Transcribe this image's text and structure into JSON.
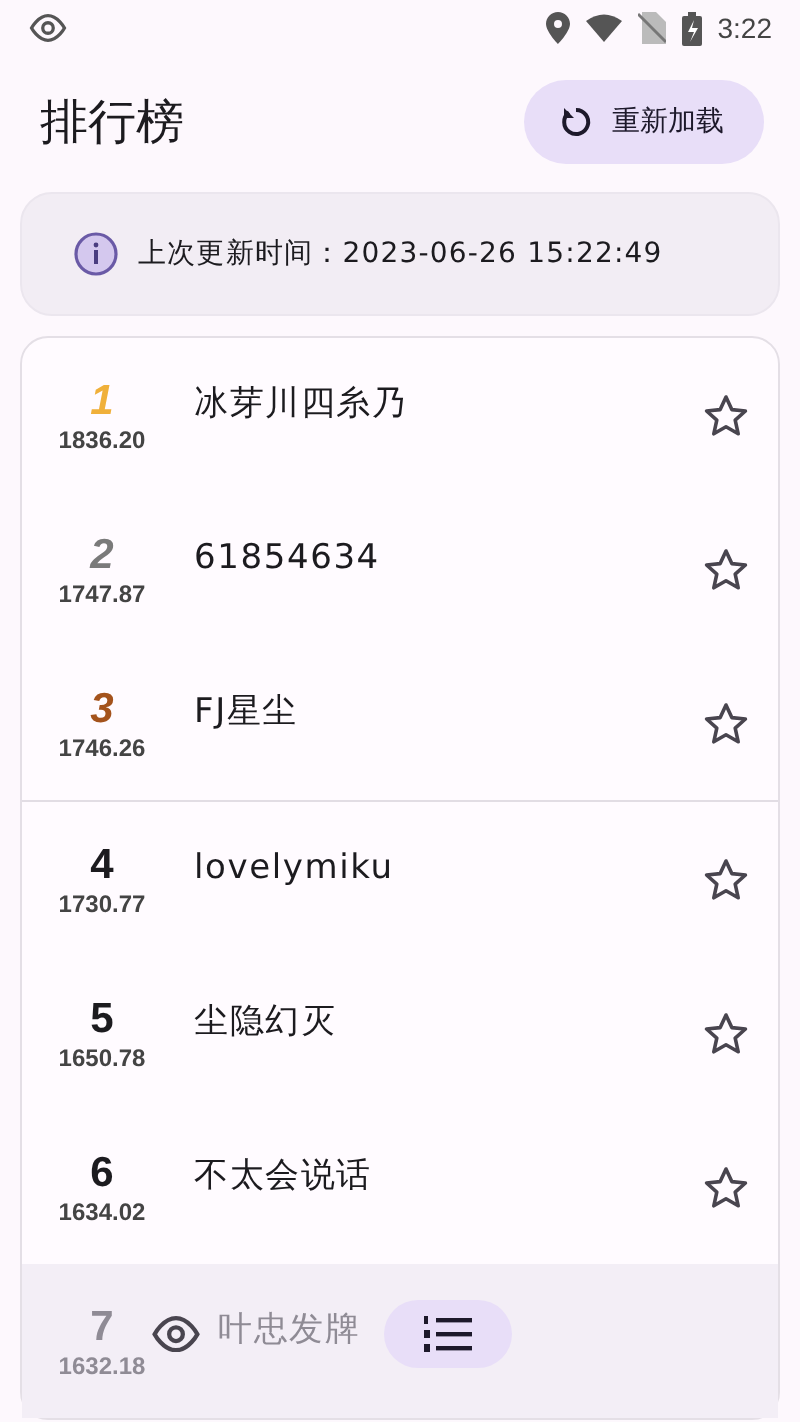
{
  "status_bar": {
    "time": "3:22"
  },
  "header": {
    "title": "排行榜",
    "reload_button": "重新加载"
  },
  "info": {
    "text": "上次更新时间：2023-06-26 15:22:49"
  },
  "rows": [
    {
      "rank": "1",
      "score": "1836.20",
      "name": "冰芽川四糸乃",
      "kind": "medal",
      "color": "#f0b03a",
      "starred": false
    },
    {
      "rank": "2",
      "score": "1747.87",
      "name": "61854634",
      "kind": "medal",
      "color": "#7a7a7a",
      "starred": false
    },
    {
      "rank": "3",
      "score": "1746.26",
      "name": "FJ星尘",
      "kind": "medal",
      "color": "#a4531c",
      "starred": false
    },
    {
      "rank": "4",
      "score": "1730.77",
      "name": "lovelymiku",
      "kind": "regular",
      "starred": false
    },
    {
      "rank": "5",
      "score": "1650.78",
      "name": "尘隐幻灭",
      "kind": "regular",
      "starred": false
    },
    {
      "rank": "6",
      "score": "1634.02",
      "name": "不太会说话",
      "kind": "regular",
      "starred": false
    },
    {
      "rank": "7",
      "score": "1632.18",
      "name": "叶忠发牌",
      "kind": "covered"
    }
  ],
  "bottom_nav": [
    {
      "selected": false
    },
    {
      "selected": true
    }
  ]
}
